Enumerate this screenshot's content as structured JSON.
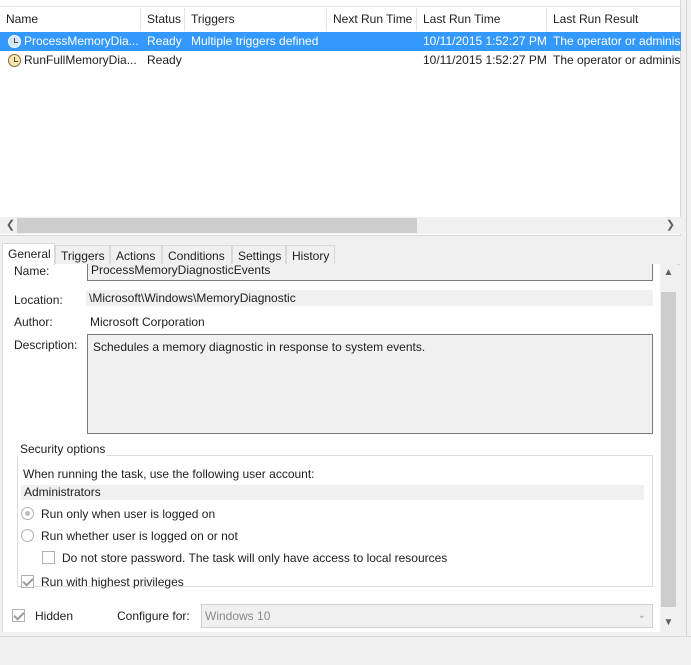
{
  "task_list": {
    "columns": [
      "Name",
      "Status",
      "Triggers",
      "Next Run Time",
      "Last Run Time",
      "Last Run Result"
    ],
    "rows": [
      {
        "name": "ProcessMemoryDia...",
        "status": "Ready",
        "triggers": "Multiple triggers defined",
        "next_run_time": "",
        "last_run_time": "10/11/2015 1:52:27 PM",
        "last_run_result": "The operator or adminis",
        "selected": true
      },
      {
        "name": "RunFullMemoryDia...",
        "status": "Ready",
        "triggers": "",
        "next_run_time": "",
        "last_run_time": "10/11/2015 1:52:27 PM",
        "last_run_result": "The operator or adminis",
        "selected": false
      }
    ],
    "selection_color": "#3399ff"
  },
  "tabs": [
    "General",
    "Triggers",
    "Actions",
    "Conditions",
    "Settings",
    "History"
  ],
  "active_tab": "General",
  "general": {
    "name_label": "Name:",
    "name_value": "ProcessMemoryDiagnosticEvents",
    "location_label": "Location:",
    "location_value": "\\Microsoft\\Windows\\MemoryDiagnostic",
    "author_label": "Author:",
    "author_value": "Microsoft Corporation",
    "description_label": "Description:",
    "description_value": "Schedules a memory diagnostic in response to system events.",
    "security": {
      "title": "Security options",
      "account_prompt": "When running the task, use the following user account:",
      "account_value": "Administrators",
      "radio_logged_on": "Run only when user is logged on",
      "radio_logged_on_checked": true,
      "radio_whether": "Run whether user is logged on or not",
      "radio_whether_checked": false,
      "no_store_password": "Do not store password.  The task will only have access to local resources",
      "no_store_password_checked": false,
      "highest_privileges": "Run with highest privileges",
      "highest_privileges_checked": true
    },
    "hidden_label": "Hidden",
    "hidden_checked": true,
    "configure_label": "Configure for:",
    "configure_value": "Windows 10"
  },
  "icons": {
    "task": "task-clock-icon",
    "scroll_left": "scroll-left-arrow-icon",
    "scroll_right": "scroll-right-arrow-icon",
    "scroll_up": "scroll-up-arrow-icon",
    "scroll_down": "scroll-down-arrow-icon",
    "dropdown": "chevron-down-icon"
  }
}
